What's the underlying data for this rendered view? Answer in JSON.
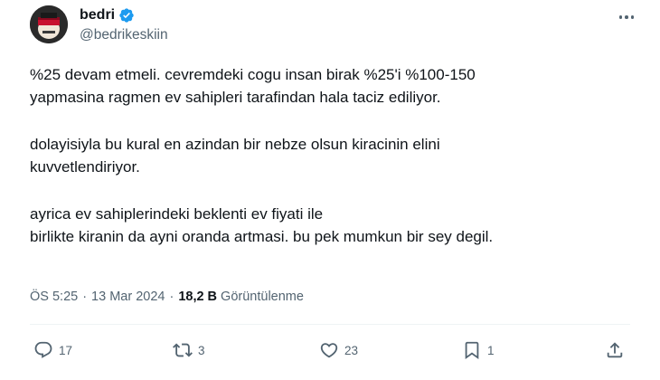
{
  "author": {
    "display_name": "bedri",
    "handle": "@bedrikeskiin",
    "verified_icon": "verified-badge-icon",
    "colors": {
      "verified": "#1d9bf0"
    }
  },
  "tweet": {
    "paragraphs": [
      [
        "%25 devam etmeli. cevremdeki cogu insan birak %25'i %100-150",
        "yapmasina ragmen ev sahipleri tarafindan hala taciz ediliyor."
      ],
      [
        "dolayisiyla bu kural en azindan bir nebze olsun kiracinin elini",
        "kuvvetlendiriyor."
      ],
      [
        "ayrica ev sahiplerindeki beklenti ev fiyati ile",
        "birlikte kiranin da ayni oranda artmasi. bu pek mumkun bir sey degil."
      ]
    ],
    "time": "ÖS 5:25",
    "separator": "·",
    "date": "13 Mar 2024",
    "views_count": "18,2 B",
    "views_label": "Görüntülenme"
  },
  "actions": {
    "reply": {
      "icon": "reply-icon",
      "count": "17"
    },
    "retweet": {
      "icon": "retweet-icon",
      "count": "3"
    },
    "like": {
      "icon": "heart-icon",
      "count": "23"
    },
    "bookmark": {
      "icon": "bookmark-icon",
      "count": "1"
    },
    "share": {
      "icon": "share-icon"
    }
  },
  "menu": {
    "icon": "more-options-icon"
  }
}
